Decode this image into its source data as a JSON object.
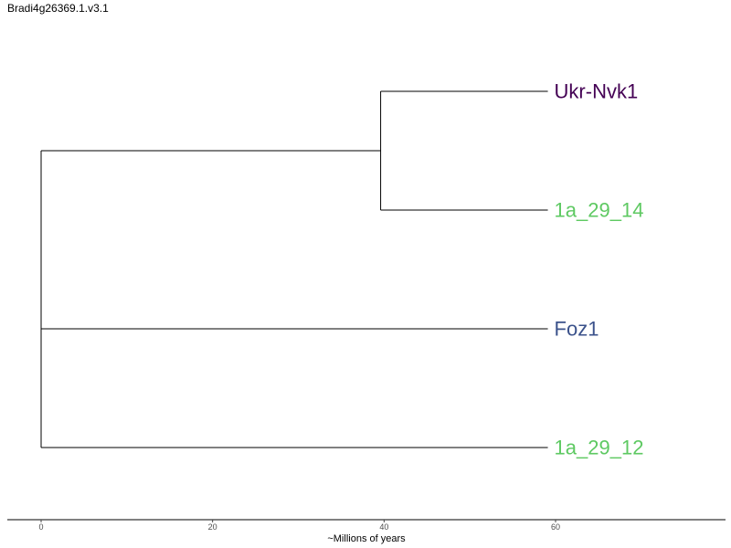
{
  "chart_data": {
    "type": "phylogenetic-tree",
    "title": "Bradi4g26369.1.v3.1",
    "xlabel": "~Millions of years",
    "xlim": [
      0,
      80
    ],
    "x_ticks": [
      0,
      20,
      40,
      60
    ],
    "grid": false,
    "tree": {
      "root_x": 0,
      "clades": [
        {
          "node_x": 39.6,
          "tips": [
            {
              "label": "Ukr-Nvk1",
              "x": 59.1,
              "color": "#440154"
            },
            {
              "label": "1a_29_14",
              "x": 59.1,
              "color": "#5ec962"
            }
          ]
        },
        {
          "tips": [
            {
              "label": "Foz1",
              "x": 59.1,
              "color": "#3b528b"
            }
          ]
        },
        {
          "tips": [
            {
              "label": "1a_29_12",
              "x": 59.1,
              "color": "#5ec962"
            }
          ]
        }
      ]
    }
  }
}
